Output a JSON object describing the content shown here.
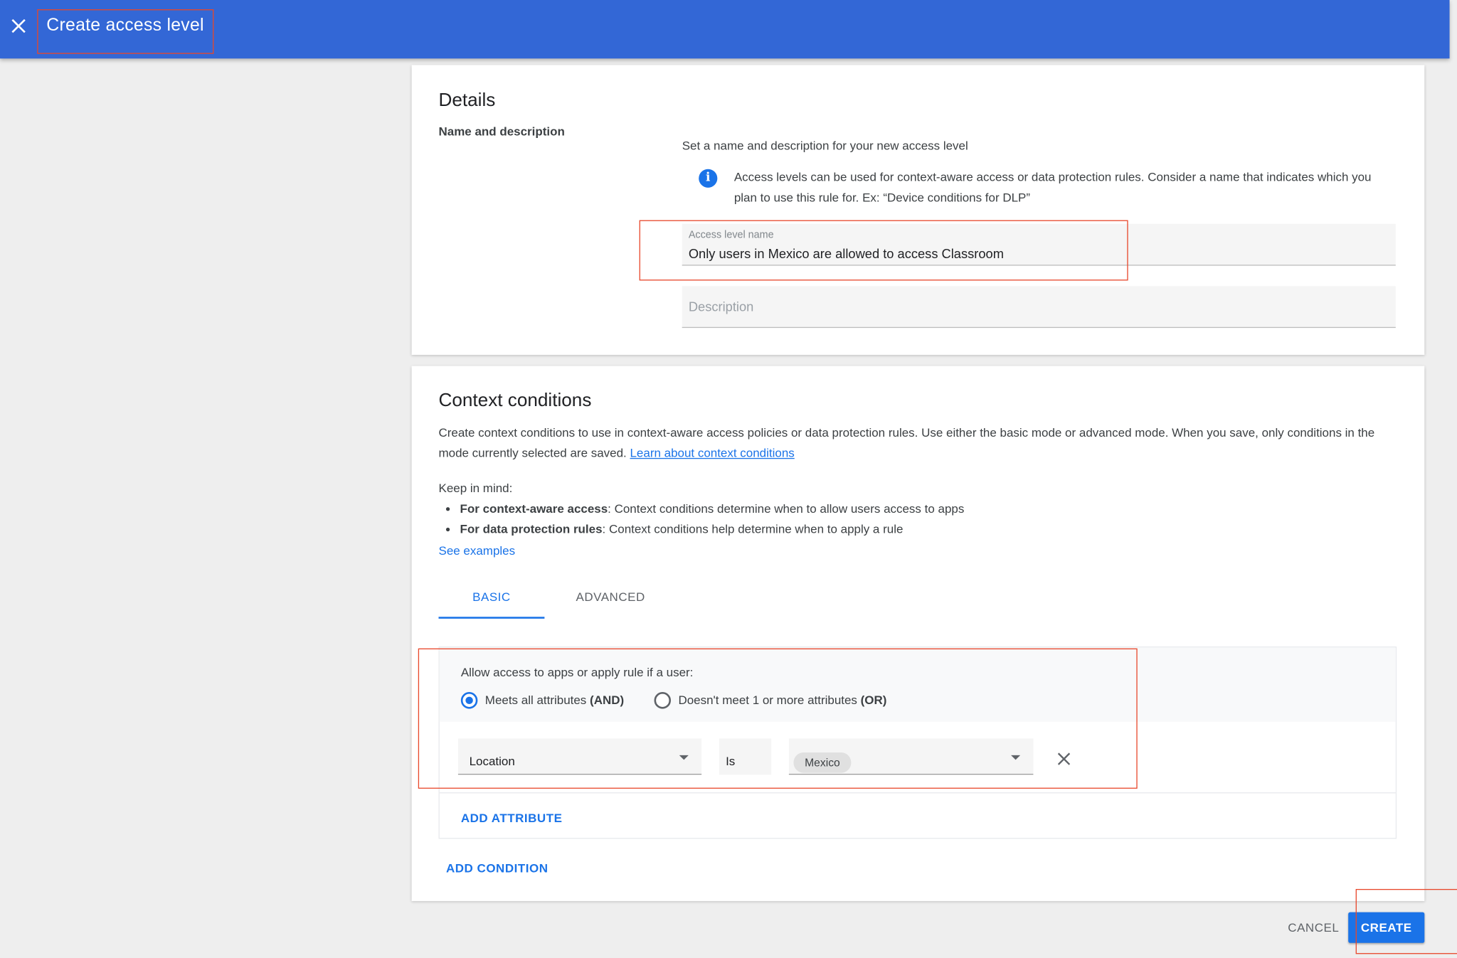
{
  "header": {
    "title": "Create access level"
  },
  "details": {
    "title": "Details",
    "subheading": "Name and description",
    "hint": "Set a name and description for your new access level",
    "info_text_line1": "Access levels can be used for context-aware access or data protection rules. Consider a name that indicates which you",
    "info_text_line2": "plan to use this rule for. Ex: “Device conditions for DLP”",
    "name_field": {
      "label": "Access level name",
      "value": "Only users in Mexico are allowed to access Classroom"
    },
    "description_field": {
      "placeholder": "Description",
      "value": ""
    }
  },
  "context": {
    "title": "Context conditions",
    "desc_line1": "Create context conditions to use in context-aware access policies or data protection rules. Use either the basic mode or advanced mode. When you save, only conditions in the",
    "desc_line2": "mode currently selected are saved.",
    "learn_link": "Learn about context conditions",
    "keep_in_mind": "Keep in mind:",
    "bullets": [
      {
        "bold": "For context-aware access",
        "rest": ": Context conditions determine when to allow users access to apps"
      },
      {
        "bold": "For data protection rules",
        "rest": ": Context conditions help determine when to apply a rule"
      }
    ],
    "see_examples": "See examples",
    "tabs": [
      {
        "label": "BASIC",
        "active": true
      },
      {
        "label": "ADVANCED",
        "active": false
      }
    ],
    "condition": {
      "prompt": "Allow access to apps or apply rule if a user:",
      "options": [
        {
          "label": "Meets all attributes",
          "suffix": "(AND)",
          "selected": true
        },
        {
          "label": "Doesn't meet 1 or more attributes",
          "suffix": "(OR)",
          "selected": false
        }
      ],
      "attribute": "Location",
      "operator": "Is",
      "value_chip": "Mexico"
    },
    "add_attribute": "ADD ATTRIBUTE",
    "add_condition": "ADD CONDITION"
  },
  "footer": {
    "cancel": "CANCEL",
    "create": "CREATE"
  },
  "colors": {
    "header_bg": "#3367d6",
    "accent": "#1a73e8",
    "annotation": "#e8472b"
  }
}
